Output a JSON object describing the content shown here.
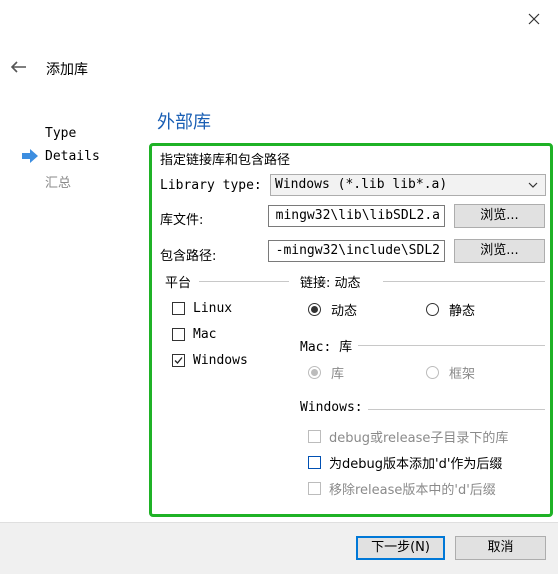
{
  "header": {
    "title": "添加库",
    "back_icon": "arrow-left-icon",
    "close_glyph": "✕"
  },
  "wizard": {
    "section_title": "外部库",
    "steps": [
      {
        "label": "Type",
        "state": "done"
      },
      {
        "label": "Details",
        "state": "current"
      },
      {
        "label": "汇总",
        "state": "pending"
      }
    ]
  },
  "form": {
    "group_title": "指定链接库和包含路径",
    "library_type": {
      "label": "Library type:",
      "value": "Windows (*.lib lib*.a)"
    },
    "library_file": {
      "label": "库文件:",
      "value": "mingw32\\lib\\libSDL2.a",
      "browse_label": "浏览..."
    },
    "include_path": {
      "label": "包含路径:",
      "value": "-mingw32\\include\\SDL2",
      "browse_label": "浏览..."
    },
    "platform": {
      "label": "平台",
      "options": [
        {
          "label": "Linux",
          "checked": false
        },
        {
          "label": "Mac",
          "checked": false
        },
        {
          "label": "Windows",
          "checked": true
        }
      ]
    },
    "linkage": {
      "label": "链接: 动态",
      "options": [
        {
          "label": "动态",
          "selected": true
        },
        {
          "label": "静态",
          "selected": false
        }
      ]
    },
    "mac": {
      "label": "Mac: 库",
      "options": [
        {
          "label": "库",
          "selected": true,
          "disabled": true
        },
        {
          "label": "框架",
          "selected": false,
          "disabled": true
        }
      ]
    },
    "windows": {
      "label": "Windows:",
      "options": [
        {
          "label": "debug或release子目录下的库",
          "checked": false,
          "disabled": true
        },
        {
          "label": "为debug版本添加'd'作为后缀",
          "checked": false,
          "disabled": false
        },
        {
          "label": "移除release版本中的'd'后缀",
          "checked": false,
          "disabled": true
        }
      ]
    }
  },
  "footer": {
    "next_label": "下一步(N)",
    "cancel_label": "取消"
  },
  "colors": {
    "accent": "#0078d7",
    "section_title": "#1a5fb4",
    "highlight_border": "#1fb226"
  }
}
